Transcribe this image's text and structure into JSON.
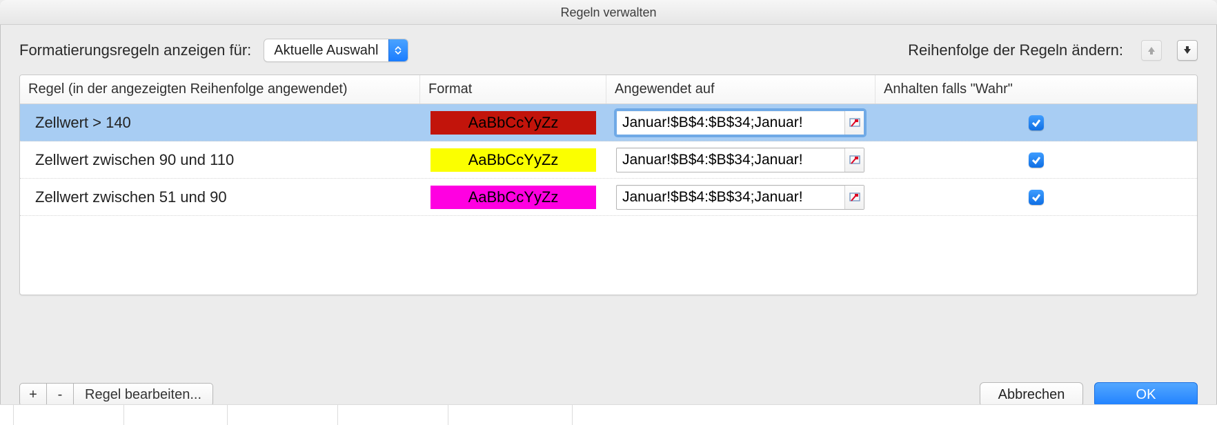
{
  "window": {
    "title": "Regeln verwalten"
  },
  "topbar": {
    "show_rules_for_label": "Formatierungsregeln anzeigen für:",
    "scope_selected": "Aktuelle Auswahl",
    "order_label": "Reihenfolge der Regeln ändern:",
    "move_up_enabled": false,
    "move_down_enabled": true
  },
  "columns": {
    "rule": "Regel (in der angezeigten Reihenfolge angewendet)",
    "format": "Format",
    "applies_to": "Angewendet auf",
    "stop_if_true": "Anhalten falls \"Wahr\""
  },
  "format_sample_text": "AaBbCcYyZz",
  "rules": [
    {
      "name": "Zellwert > 140",
      "format_bg": "#c2140b",
      "format_fg": "#000000",
      "applies_to": "Januar!$B$4:$B$34;Januar!",
      "stop_if_true": true,
      "selected": true
    },
    {
      "name": "Zellwert zwischen 90 und 110",
      "format_bg": "#fbff00",
      "format_fg": "#000000",
      "applies_to": "Januar!$B$4:$B$34;Januar!",
      "stop_if_true": true,
      "selected": false
    },
    {
      "name": "Zellwert zwischen 51 und 90",
      "format_bg": "#ff00e1",
      "format_fg": "#000000",
      "applies_to": "Januar!$B$4:$B$34;Januar!",
      "stop_if_true": true,
      "selected": false
    }
  ],
  "footer": {
    "add_label": "+",
    "remove_label": "-",
    "edit_label": "Regel bearbeiten...",
    "cancel_label": "Abbrechen",
    "ok_label": "OK"
  }
}
